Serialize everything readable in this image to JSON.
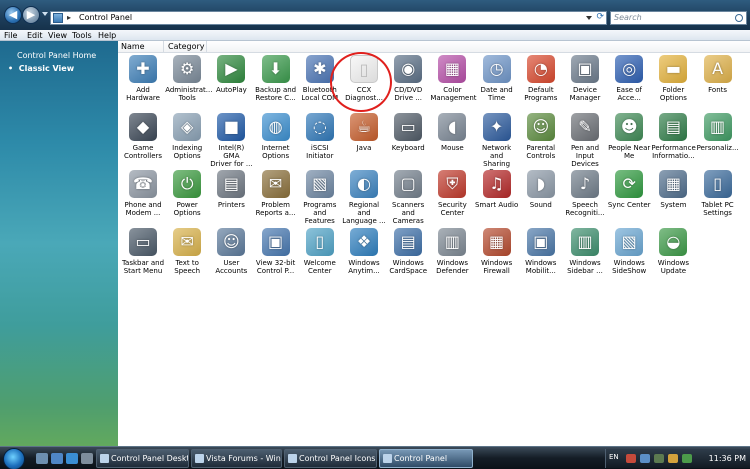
{
  "window": {
    "address": "Control Panel",
    "search_placeholder": "Search"
  },
  "menu": {
    "items": [
      "File",
      "Edit",
      "View",
      "Tools",
      "Help"
    ]
  },
  "left_pane": {
    "home_label": "Control Panel Home",
    "classic_label": "Classic View",
    "bullet": "•"
  },
  "columns": {
    "name": "Name",
    "category": "Category"
  },
  "items": [
    {
      "label": "Add\nHardware",
      "color": "#3d7fb8",
      "glyph": "✚"
    },
    {
      "label": "Administrat...\nTools",
      "color": "#7b8a99",
      "glyph": "⚙"
    },
    {
      "label": "AutoPlay",
      "color": "#2f8a3e",
      "glyph": "▶"
    },
    {
      "label": "Backup and\nRestore C...",
      "color": "#3a9a4c",
      "glyph": "⬇"
    },
    {
      "label": "Bluetooth\nLocal COM",
      "color": "#4a74b5",
      "glyph": "✱"
    },
    {
      "label": "CCX\nDiagnost...",
      "color": "#f4f4f4",
      "glyph": "▯"
    },
    {
      "label": "CD/DVD\nDrive ...",
      "color": "#5b6f86",
      "glyph": "◉"
    },
    {
      "label": "Color\nManagement",
      "color": "#b64ea8",
      "glyph": "▦"
    },
    {
      "label": "Date and\nTime",
      "color": "#6f96c9",
      "glyph": "◷"
    },
    {
      "label": "Default\nPrograms",
      "color": "#d9482d",
      "glyph": "◔"
    },
    {
      "label": "Device\nManager",
      "color": "#6c7b8c",
      "glyph": "▣"
    },
    {
      "label": "Ease of\nAcce...",
      "color": "#2d5fb3",
      "glyph": "◎"
    },
    {
      "label": "Folder\nOptions",
      "color": "#e4b23b",
      "glyph": "▬"
    },
    {
      "label": "Fonts",
      "color": "#e0b24a",
      "glyph": "A"
    },
    {
      "label": "Game\nControllers",
      "color": "#3b4756",
      "glyph": "◆"
    },
    {
      "label": "Indexing\nOptions",
      "color": "#8aa1b5",
      "glyph": "◈"
    },
    {
      "label": "Intel(R) GMA\nDriver for ...",
      "color": "#1f5aa8",
      "glyph": "■"
    },
    {
      "label": "Internet\nOptions",
      "color": "#3b8fd0",
      "glyph": "◍"
    },
    {
      "label": "iSCSI Initiator",
      "color": "#2f78b9",
      "glyph": "◌"
    },
    {
      "label": "Java",
      "color": "#c75d2b",
      "glyph": "☕"
    },
    {
      "label": "Keyboard",
      "color": "#4f5a66",
      "glyph": "▭"
    },
    {
      "label": "Mouse",
      "color": "#7a8694",
      "glyph": "◖"
    },
    {
      "label": "Network and\nSharing Ce...",
      "color": "#2c5b9e",
      "glyph": "✦"
    },
    {
      "label": "Parental\nControls",
      "color": "#5c8c3e",
      "glyph": "☺"
    },
    {
      "label": "Pen and\nInput Devices",
      "color": "#6b6f75",
      "glyph": "✎"
    },
    {
      "label": "People Near\nMe",
      "color": "#3f8a55",
      "glyph": "☻"
    },
    {
      "label": "Performance\nInformatio...",
      "color": "#2f7d48",
      "glyph": "▤"
    },
    {
      "label": "Personaliz...",
      "color": "#3f9b63",
      "glyph": "▥"
    },
    {
      "label": "Phone and\nModem ...",
      "color": "#8d97a3",
      "glyph": "☎"
    },
    {
      "label": "Power\nOptions",
      "color": "#3a9a3e",
      "glyph": "⏻"
    },
    {
      "label": "Printers",
      "color": "#6e7782",
      "glyph": "▤"
    },
    {
      "label": "Problem\nReports a...",
      "color": "#8a6f3a",
      "glyph": "✉"
    },
    {
      "label": "Programs\nand Features",
      "color": "#6d86a2",
      "glyph": "▧"
    },
    {
      "label": "Regional and\nLanguage ...",
      "color": "#3b83c0",
      "glyph": "◐"
    },
    {
      "label": "Scanners and\nCameras",
      "color": "#737f8c",
      "glyph": "▢"
    },
    {
      "label": "Security\nCenter",
      "color": "#c0392b",
      "glyph": "⛨"
    },
    {
      "label": "Smart Audio",
      "color": "#b52828",
      "glyph": "♫"
    },
    {
      "label": "Sound",
      "color": "#8c99a7",
      "glyph": "◗"
    },
    {
      "label": "Speech\nRecogniti...",
      "color": "#6f7c89",
      "glyph": "♪"
    },
    {
      "label": "Sync Center",
      "color": "#2f9a3f",
      "glyph": "⟳"
    },
    {
      "label": "System",
      "color": "#4f6d8c",
      "glyph": "▦"
    },
    {
      "label": "Tablet PC\nSettings",
      "color": "#3b6b9c",
      "glyph": "▯"
    },
    {
      "label": "Taskbar and\nStart Menu",
      "color": "#4a5968",
      "glyph": "▭"
    },
    {
      "label": "Text to\nSpeech",
      "color": "#d9b24a",
      "glyph": "✉"
    },
    {
      "label": "User\nAccounts",
      "color": "#5c7a9b",
      "glyph": "☺"
    },
    {
      "label": "View 32-bit\nControl P...",
      "color": "#4677b0",
      "glyph": "▣"
    },
    {
      "label": "Welcome\nCenter",
      "color": "#4fa3c7",
      "glyph": "▯"
    },
    {
      "label": "Windows\nAnytim...",
      "color": "#2e7fbf",
      "glyph": "❖"
    },
    {
      "label": "Windows\nCardSpace",
      "color": "#3d6fa8",
      "glyph": "▤"
    },
    {
      "label": "Windows\nDefender",
      "color": "#7d8893",
      "glyph": "▥"
    },
    {
      "label": "Windows\nFirewall",
      "color": "#b5492d",
      "glyph": "▦"
    },
    {
      "label": "Windows\nMobilit...",
      "color": "#4a77a8",
      "glyph": "▣"
    },
    {
      "label": "Windows\nSidebar ...",
      "color": "#3d8f6e",
      "glyph": "▥"
    },
    {
      "label": "Windows\nSideShow",
      "color": "#6aa7d3",
      "glyph": "▧"
    },
    {
      "label": "Windows\nUpdate",
      "color": "#3c9a47",
      "glyph": "◒"
    }
  ],
  "taskbar": {
    "tasks": [
      {
        "label": "Control Panel Deskt..."
      },
      {
        "label": "Vista Forums - Wind..."
      },
      {
        "label": "Control Panel Icons ..."
      },
      {
        "label": "Control Panel"
      }
    ],
    "lang": "EN",
    "clock": "11:36 PM"
  }
}
